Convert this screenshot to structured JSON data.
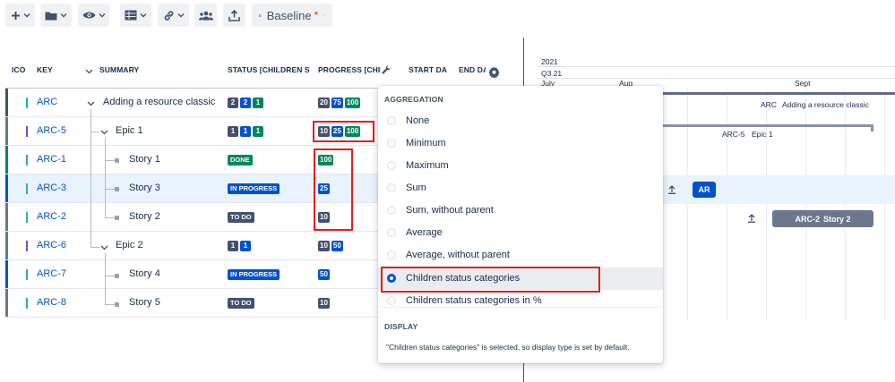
{
  "toolbar": {
    "baseline_label": "Baseline",
    "baseline_modified": "*"
  },
  "columns": {
    "icon": "ICO",
    "key": "KEY",
    "summary": "SUMMARY",
    "status": "STATUS [CHILDREN ST",
    "progress": "PROGRESS [CHIL",
    "start": "START DA",
    "end": "END DA"
  },
  "rows": [
    {
      "key": "ARC",
      "summary": "Adding a resource classic",
      "status_counts": [
        "2",
        "2",
        "1"
      ],
      "progress": [
        "20",
        "75",
        "100"
      ],
      "bar_color": "#42526e",
      "mark_color": "#00b8d9"
    },
    {
      "key": "ARC-5",
      "summary": "Epic 1",
      "status_counts": [
        "1",
        "1",
        "1"
      ],
      "progress": [
        "10",
        "25",
        "100"
      ],
      "bar_color": "#6b778c",
      "mark_color": "#6554c0"
    },
    {
      "key": "ARC-1",
      "summary": "Story 1",
      "status_pill": "DONE",
      "progress": [
        "100"
      ],
      "bar_color": "#00875a",
      "mark_color": "#36b37e"
    },
    {
      "key": "ARC-3",
      "summary": "Story 3",
      "status_pill": "IN PROGRESS",
      "progress": [
        "25"
      ],
      "bar_color": "#0052cc",
      "mark_color": "#36b37e"
    },
    {
      "key": "ARC-2",
      "summary": "Story 2",
      "status_pill": "TO DO",
      "progress": [
        "10"
      ],
      "bar_color": "#6b778c",
      "mark_color": "#36b37e"
    },
    {
      "key": "ARC-6",
      "summary": "Epic 2",
      "status_counts": [
        "1",
        "1"
      ],
      "progress": [
        "10",
        "50"
      ],
      "bar_color": "#6b778c",
      "mark_color": "#6554c0"
    },
    {
      "key": "ARC-7",
      "summary": "Story 4",
      "status_pill": "IN PROGRESS",
      "progress": [
        "50"
      ],
      "bar_color": "#0052cc",
      "mark_color": "#36b37e"
    },
    {
      "key": "ARC-8",
      "summary": "Story 5",
      "status_pill": "TO DO",
      "progress": [
        "10"
      ],
      "bar_color": "#6b778c",
      "mark_color": "#36b37e"
    }
  ],
  "gantt": {
    "year": "2021",
    "quarter": "Q3 21",
    "months": [
      "July",
      "Aug",
      "Sept"
    ],
    "arc_label_key": "ARC",
    "arc_label_summary": "Adding a resource classic",
    "epic_label_key": "ARC-5",
    "epic_label_summary": "Epic 1",
    "ar_label": "AR",
    "arc2_key": "ARC-2",
    "arc2_summary": "Story 2"
  },
  "dropdown": {
    "aggregation_heading": "AGGREGATION",
    "options": [
      "None",
      "Minimum",
      "Maximum",
      "Sum",
      "Sum, without parent",
      "Average",
      "Average, without parent",
      "Children status categories",
      "Children status categories in %"
    ],
    "selected_index": 7,
    "display_heading": "DISPLAY",
    "display_note": "\"Children status categories\" is selected, so display type is set by default."
  },
  "colors": {
    "accent": "#0052cc",
    "done": "#00875a",
    "todo": "#42526e",
    "highlight": "#e0201c"
  }
}
